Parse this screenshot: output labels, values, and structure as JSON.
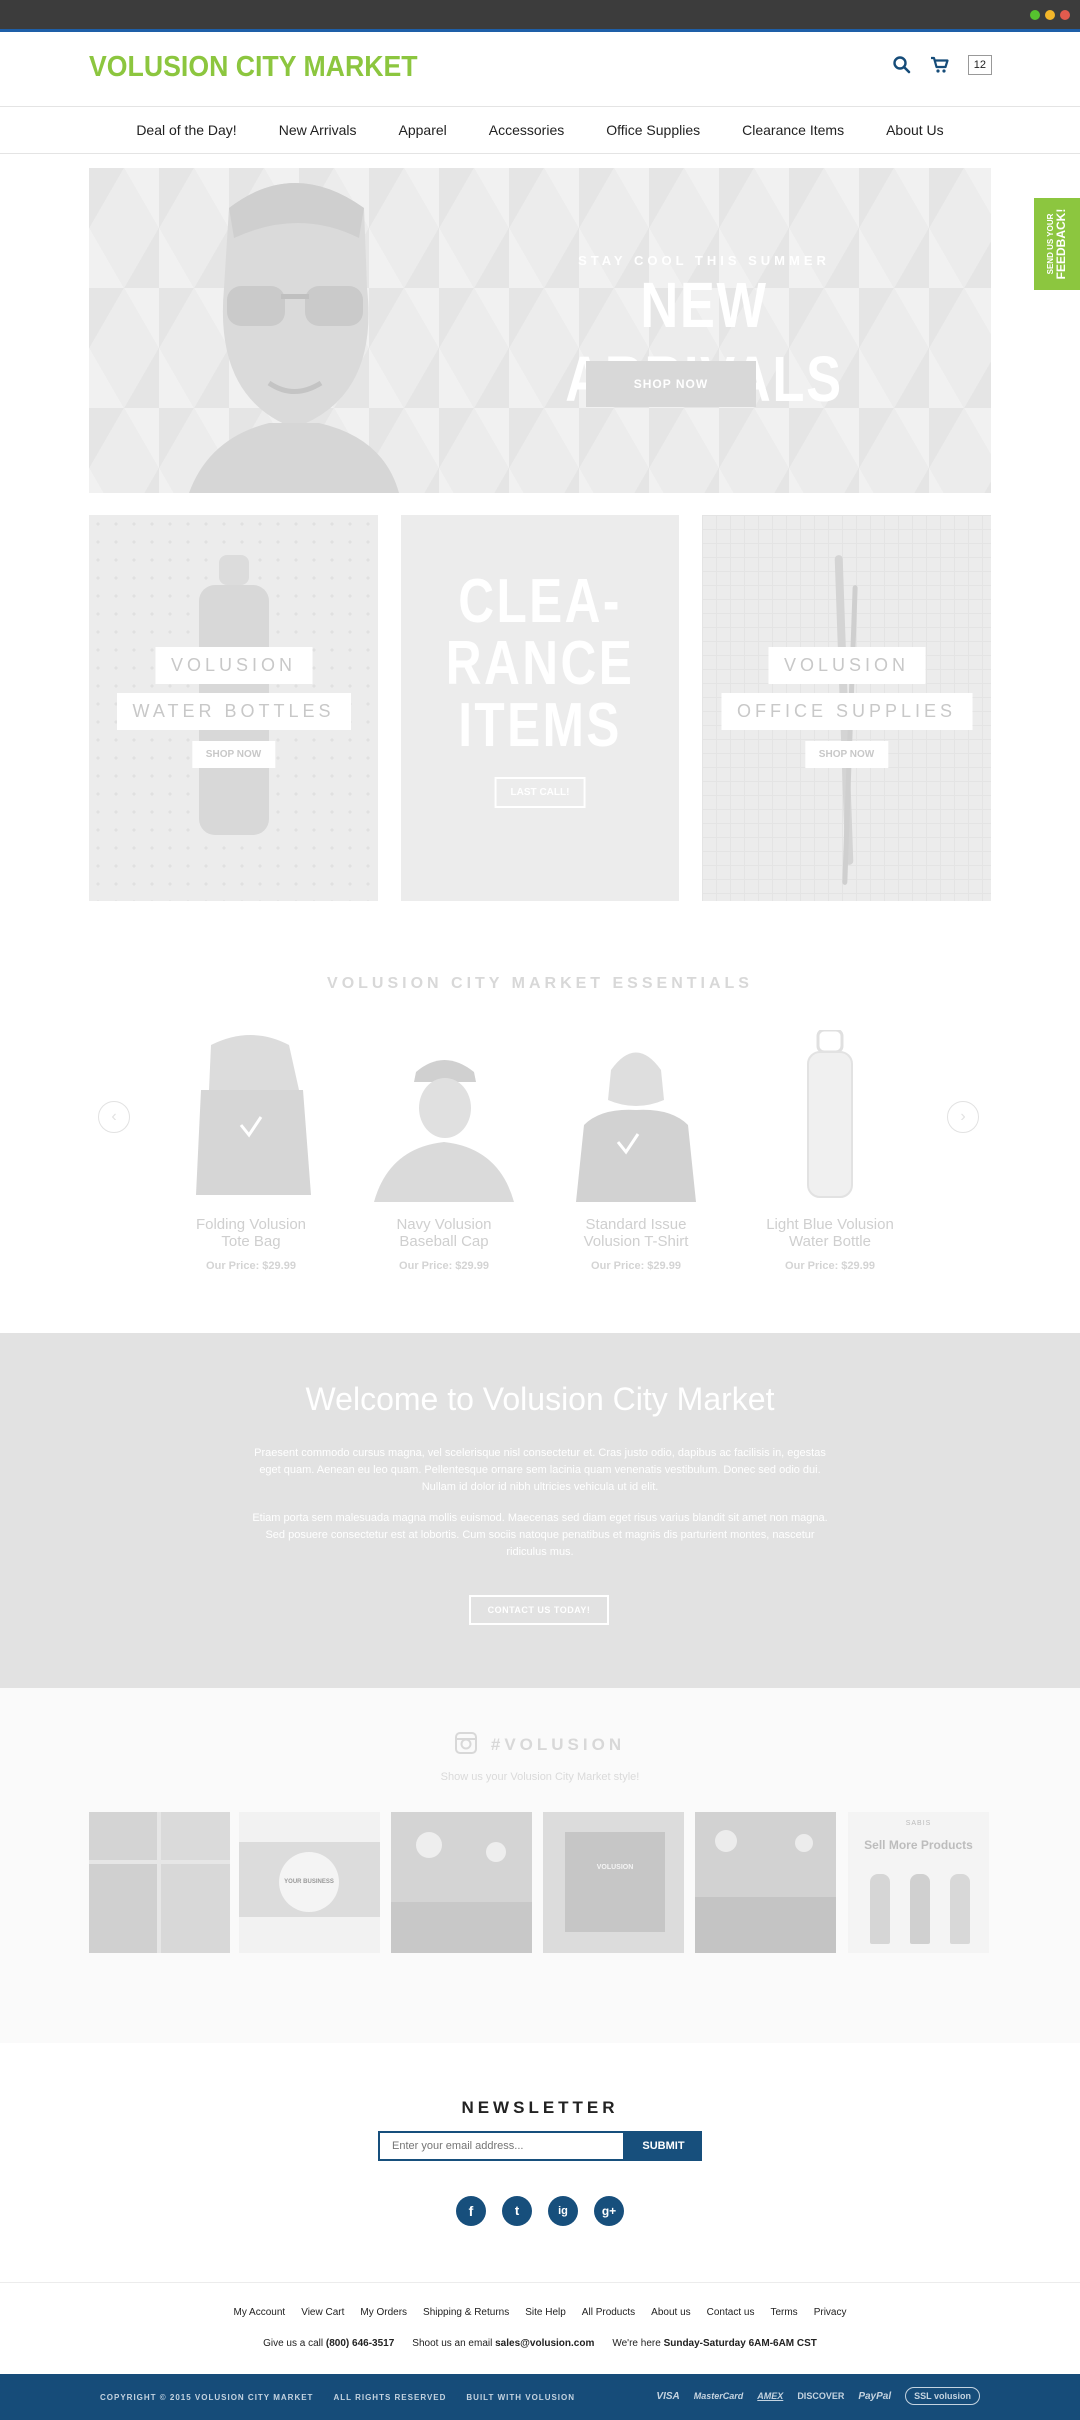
{
  "window": {
    "dots": [
      "#56c22f",
      "#f3b62a",
      "#e15b4e"
    ]
  },
  "header": {
    "logo": "VOLUSION CITY MARKET",
    "logo_color": "#8cc63f",
    "cart_count": "12"
  },
  "nav": {
    "items": [
      "Deal of the Day!",
      "New Arrivals",
      "Apparel",
      "Accessories",
      "Office Supplies",
      "Clearance Items",
      "About Us"
    ]
  },
  "hero": {
    "subtitle": "STAY COOL THIS SUMMER",
    "title": "NEW ARRIVALS",
    "button": "SHOP NOW"
  },
  "tiles": [
    {
      "label1": "VOLUSION",
      "label2": "WATER BOTTLES",
      "button": "SHOP NOW"
    },
    {
      "title_line1": "CLEA-",
      "title_line2": "RANCE",
      "title_line3": "ITEMS",
      "button": "LAST CALL!"
    },
    {
      "label1": "VOLUSION",
      "label2": "OFFICE SUPPLIES",
      "button": "SHOP NOW"
    }
  ],
  "essentials": {
    "title": "VOLUSION CITY MARKET ESSENTIALS",
    "products": [
      {
        "name1": "Folding Volusion",
        "name2": "Tote Bag",
        "price": "Our Price: $29.99"
      },
      {
        "name1": "Navy Volusion",
        "name2": "Baseball Cap",
        "price": "Our Price: $29.99"
      },
      {
        "name1": "Standard Issue",
        "name2": "Volusion T-Shirt",
        "price": "Our Price: $29.99"
      },
      {
        "name1": "Light Blue Volusion",
        "name2": "Water Bottle",
        "price": "Our Price: $29.99"
      }
    ]
  },
  "welcome": {
    "title": "Welcome to Volusion City Market",
    "p1": "Praesent commodo cursus magna, vel scelerisque nisl consectetur et. Cras justo odio, dapibus ac facilisis in, egestas eget quam. Aenean eu leo quam. Pellentesque ornare sem lacinia quam venenatis vestibulum. Donec sed odio dui. Nullam id dolor id nibh ultricies vehicula ut id elit.",
    "p2": "Etiam porta sem malesuada magna mollis euismod. Maecenas sed diam eget risus varius blandit sit amet non magna. Sed posuere consectetur est at lobortis. Cum sociis natoque penatibus et magnis dis parturient montes, nascetur ridiculus mus.",
    "button": "CONTACT US TODAY!"
  },
  "instagram": {
    "title": "#VOLUSION",
    "subtitle": "Show us your Volusion City Market style!",
    "img2_text": "YOUR BUSINESS",
    "img4_text": "VOLUSION",
    "img6_brand": "SABIS",
    "img6_text": "Sell More Products"
  },
  "newsletter": {
    "title": "NEWSLETTER",
    "placeholder": "Enter your email address...",
    "button": "SUBMIT"
  },
  "social": [
    "f",
    "t",
    "ig",
    "g+"
  ],
  "footer": {
    "links": [
      "My Account",
      "View Cart",
      "My Orders",
      "Shipping & Returns",
      "Site Help",
      "All Products",
      "About us",
      "Contact us",
      "Terms",
      "Privacy"
    ],
    "call_label": "Give us a call",
    "phone": "(800) 646-3517",
    "email_label": "Shoot us an email",
    "email": "sales@volusion.com",
    "hours_label": "We're here",
    "hours": "Sunday-Saturday 6AM-6AM CST",
    "copyright": "COPYRIGHT © 2015 VOLUSION CITY MARKET",
    "rights": "ALL RIGHTS RESERVED",
    "built": "BUILT WITH VOLUSION",
    "payments": [
      "VISA",
      "MasterCard",
      "AMEX",
      "DISCOVER",
      "PayPal"
    ],
    "ssl": "volusion"
  },
  "feedback": {
    "line1": "SEND US YOUR",
    "line2": "FEEDBACK!"
  }
}
